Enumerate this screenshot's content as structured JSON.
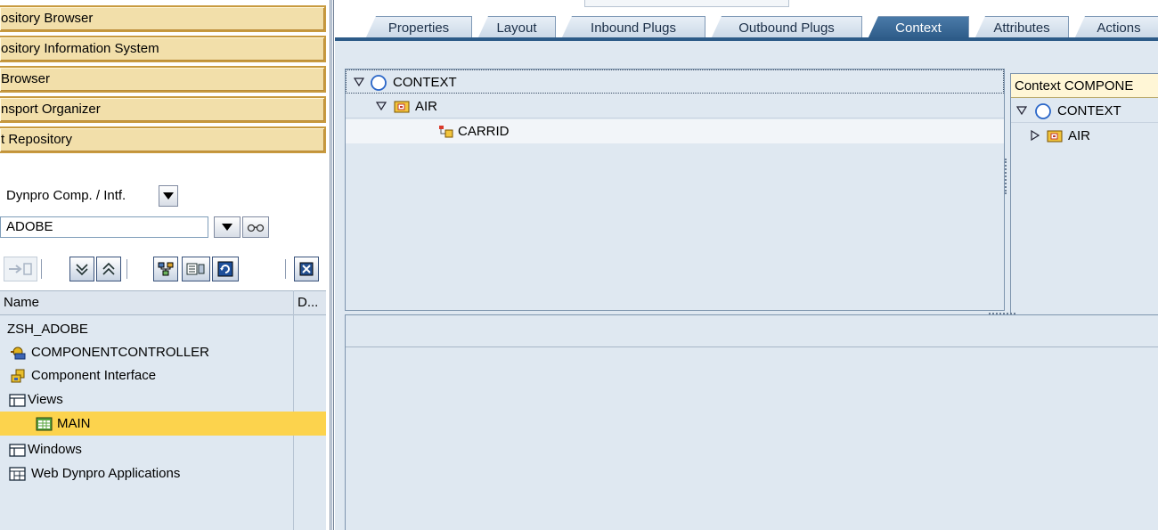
{
  "nav": {
    "items": [
      {
        "label": "ository Browser"
      },
      {
        "label": "ository Information System"
      },
      {
        "label": " Browser"
      },
      {
        "label": "nsport Organizer"
      },
      {
        "label": "t Repository"
      }
    ]
  },
  "object_selector": {
    "type_value": "Dynpro Comp. / Intf.",
    "name_value": "ADOBE"
  },
  "tree": {
    "columns": [
      "Name",
      "D..."
    ],
    "rows": [
      {
        "label": "ZSH_ADOBE",
        "icon": "none"
      },
      {
        "label": "COMPONENTCONTROLLER",
        "icon": "component-controller-icon"
      },
      {
        "label": "Component Interface",
        "icon": "component-interface-icon"
      },
      {
        "label": "Views",
        "icon": "folder-icon"
      },
      {
        "label": "MAIN",
        "icon": "view-icon",
        "selected": true
      },
      {
        "label": "Windows",
        "icon": "folder-icon"
      },
      {
        "label": "Web Dynpro Applications",
        "icon": "applications-icon"
      }
    ]
  },
  "tabs": [
    {
      "label": "Properties"
    },
    {
      "label": "Layout"
    },
    {
      "label": "Inbound Plugs"
    },
    {
      "label": "Outbound Plugs"
    },
    {
      "label": "Context",
      "active": true
    },
    {
      "label": "Attributes"
    },
    {
      "label": "Actions"
    }
  ],
  "view_context": {
    "root": "CONTEXT",
    "node": "AIR",
    "attribute": "CARRID"
  },
  "component_context": {
    "header": "Context COMPONE",
    "root": "CONTEXT",
    "node": "AIR"
  },
  "colors": {
    "nav_button": "#f2dfaa",
    "selected_row": "#fcd34d",
    "tab_active": "#2d5b88",
    "panel_bg": "#dfe8f1"
  }
}
